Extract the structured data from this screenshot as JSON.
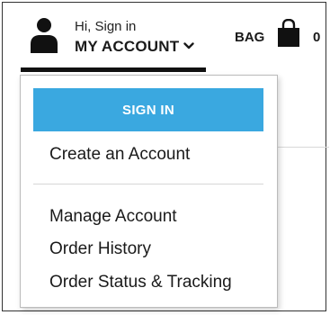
{
  "header": {
    "greeting": "Hi, Sign in",
    "account_label": "MY ACCOUNT",
    "bag_label": "BAG",
    "bag_count": "0"
  },
  "dropdown": {
    "sign_in_label": "SIGN IN",
    "create_account_label": "Create an Account",
    "items": [
      {
        "label": "Manage Account"
      },
      {
        "label": "Order History"
      },
      {
        "label": "Order Status & Tracking"
      }
    ]
  },
  "colors": {
    "accent": "#3aa8e0",
    "text": "#1a1a1a",
    "underline": "#111111"
  },
  "icons": {
    "account": "person-icon",
    "menu_toggle": "chevron-down-icon",
    "bag": "shopping-bag-icon"
  }
}
